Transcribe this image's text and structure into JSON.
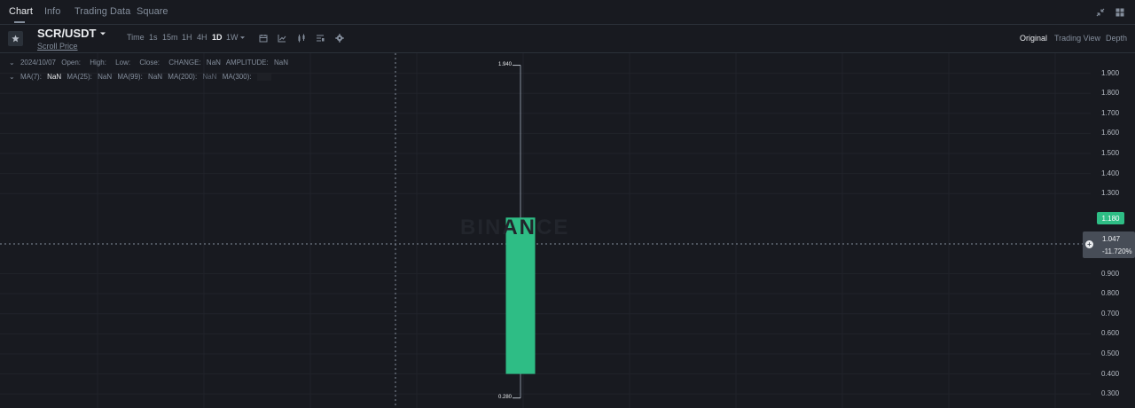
{
  "tabs": [
    {
      "label": "Chart",
      "active": true
    },
    {
      "label": "Info"
    },
    {
      "label": "Trading Data"
    },
    {
      "label": "Square"
    }
  ],
  "top_icons": [
    "collapse-icon",
    "grid-layout-icon"
  ],
  "symbol": {
    "pair": "SCR/USDT",
    "subtitle": "Scroll Price"
  },
  "timeframes": [
    {
      "label": "Time"
    },
    {
      "label": "1s"
    },
    {
      "label": "15m"
    },
    {
      "label": "1H"
    },
    {
      "label": "4H"
    },
    {
      "label": "1D",
      "active": true
    },
    {
      "label": "1W"
    }
  ],
  "toolbar_icons": [
    "calendar-icon",
    "chart-type-icon",
    "indicators-icon",
    "settings-list-icon",
    "gear-icon"
  ],
  "views": [
    {
      "label": "Original",
      "active": true
    },
    {
      "label": "Trading View"
    },
    {
      "label": "Depth"
    }
  ],
  "info": {
    "date": "2024/10/07",
    "open_label": "Open:",
    "high_label": "High:",
    "low_label": "Low:",
    "close_label": "Close:",
    "change_label": "CHANGE:",
    "change_value": "NaN",
    "amplitude_label": "AMPLITUDE:",
    "amplitude_value": "NaN"
  },
  "ma": {
    "ma7_label": "MA(7):",
    "ma7_value": "NaN",
    "ma25_label": "MA(25):",
    "ma25_value": "NaN",
    "ma99_label": "MA(99):",
    "ma99_value": "NaN",
    "ma200_label": "MA(200):",
    "ma200_value": "NaN",
    "ma300_label": "MA(300):"
  },
  "watermark": "BINANCE",
  "colors": {
    "up": "#2ebd85",
    "background": "#181a20",
    "grid": "#20232a"
  },
  "chart_data": {
    "type": "candlestick",
    "candles": [
      {
        "date": "2024/10/07",
        "open": 0.4,
        "high": 1.94,
        "low": 0.28,
        "close": 1.18
      }
    ],
    "high_label": "1.940",
    "low_label": "0.280",
    "y_ticks": [
      "1.900",
      "1.800",
      "1.700",
      "1.600",
      "1.500",
      "1.400",
      "1.300",
      "0.900",
      "0.800",
      "0.700",
      "0.600",
      "0.500",
      "0.400",
      "0.300"
    ],
    "y_tick_values": [
      1.9,
      1.8,
      1.7,
      1.6,
      1.5,
      1.4,
      1.3,
      0.9,
      0.8,
      0.7,
      0.6,
      0.5,
      0.4,
      0.3
    ],
    "ylim": [
      0.23,
      2.0
    ],
    "current_price": "1.180",
    "crosshair_price": "1.047",
    "crosshair_change": "-11.720%"
  }
}
